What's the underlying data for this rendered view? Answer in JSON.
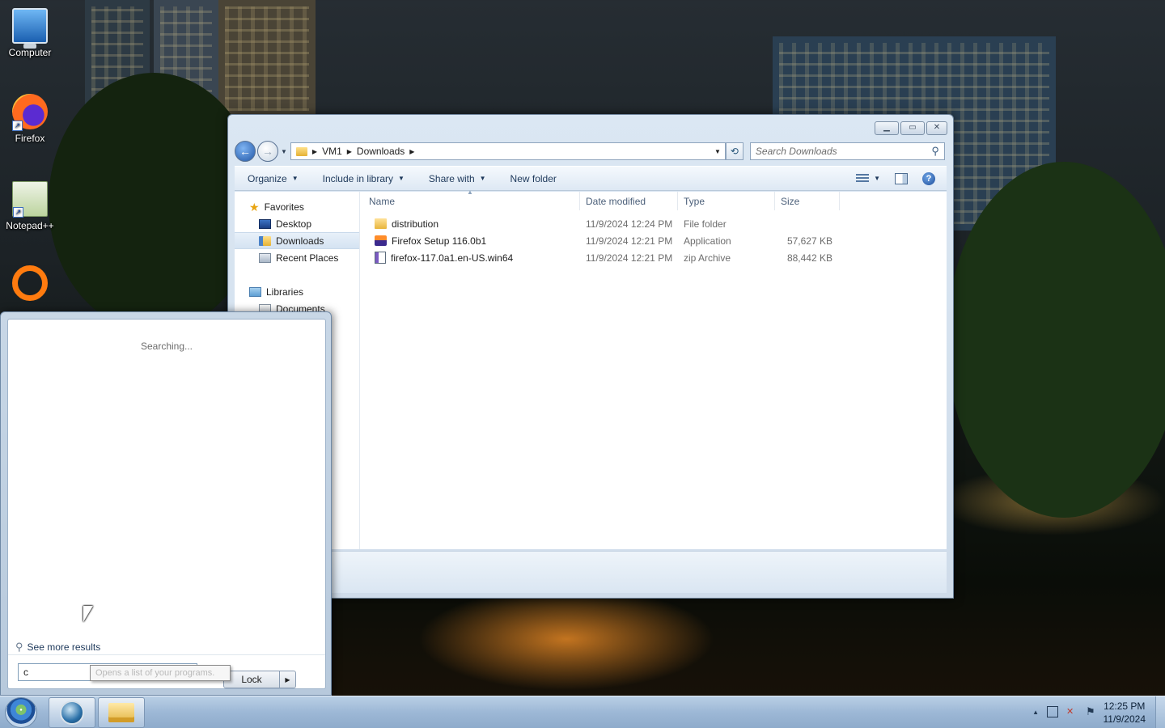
{
  "desktop": {
    "icons": [
      {
        "label": "Computer",
        "icon": "computer-icon"
      },
      {
        "label": "Firefox",
        "icon": "firefox-icon"
      },
      {
        "label": "Notepad++",
        "icon": "notepadpp-icon"
      },
      {
        "label": "",
        "icon": "ring-app-icon"
      }
    ]
  },
  "explorer": {
    "breadcrumb": [
      "VM1",
      "Downloads"
    ],
    "search_placeholder": "Search Downloads",
    "toolbar": {
      "organize": "Organize",
      "include_in_library": "Include in library",
      "share_with": "Share with",
      "new_folder": "New folder"
    },
    "nav": {
      "favorites": "Favorites",
      "desktop": "Desktop",
      "downloads": "Downloads",
      "recent_places": "Recent Places",
      "libraries": "Libraries",
      "documents": "Documents"
    },
    "columns": {
      "name": "Name",
      "date": "Date modified",
      "type": "Type",
      "size": "Size"
    },
    "files": [
      {
        "name": "distribution",
        "date": "11/9/2024 12:24 PM",
        "type": "File folder",
        "size": "",
        "icon": "folder-icon"
      },
      {
        "name": "Firefox Setup 116.0b1",
        "date": "11/9/2024 12:21 PM",
        "type": "Application",
        "size": "57,627 KB",
        "icon": "installer-icon"
      },
      {
        "name": "firefox-117.0a1.en-US.win64",
        "date": "11/9/2024 12:21 PM",
        "type": "zip Archive",
        "size": "88,442 KB",
        "icon": "zip-icon"
      }
    ]
  },
  "start_menu": {
    "status": "Searching...",
    "see_more": "See more results",
    "search_value": "c",
    "tooltip": "Opens a list of your programs.",
    "lock_label": "Lock"
  },
  "taskbar": {
    "time": "12:25 PM",
    "date": "11/9/2024"
  }
}
